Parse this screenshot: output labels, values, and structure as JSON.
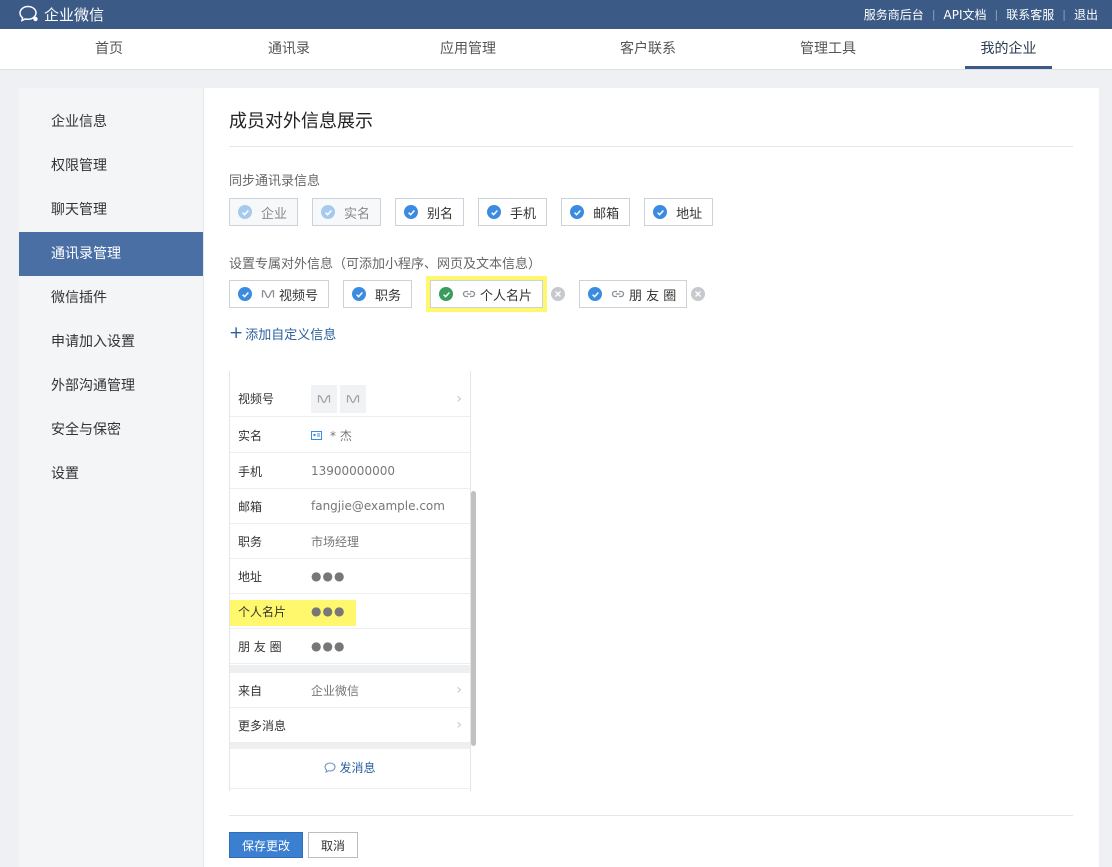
{
  "app": {
    "title": "企业微信"
  },
  "top_links": [
    "服务商后台",
    "API文档",
    "联系客服",
    "退出"
  ],
  "nav": {
    "tabs": [
      "首页",
      "通讯录",
      "应用管理",
      "客户联系",
      "管理工具",
      "我的企业"
    ],
    "active": "我的企业"
  },
  "sidebar": {
    "items": [
      "企业信息",
      "权限管理",
      "聊天管理",
      "通讯录管理",
      "微信插件",
      "申请加入设置",
      "外部沟通管理",
      "安全与保密",
      "设置"
    ],
    "active": "通讯录管理"
  },
  "main": {
    "title": "成员对外信息展示",
    "sync_label": "同步通讯录信息",
    "sync_items": [
      {
        "label": "企业",
        "checked": true,
        "disabled": true
      },
      {
        "label": "实名",
        "checked": true,
        "disabled": true
      },
      {
        "label": "别名",
        "checked": true,
        "disabled": false
      },
      {
        "label": "手机",
        "checked": true,
        "disabled": false
      },
      {
        "label": "邮箱",
        "checked": true,
        "disabled": false
      },
      {
        "label": "地址",
        "checked": true,
        "disabled": false
      }
    ],
    "custom_label": "设置专属对外信息（可添加小程序、网页及文本信息）",
    "custom_items": [
      {
        "label": "视频号",
        "icon": "channels-icon",
        "removable": false
      },
      {
        "label": "职务",
        "icon": "",
        "removable": false
      },
      {
        "label": "个人名片",
        "icon": "link-icon",
        "removable": true,
        "highlighted": true
      },
      {
        "label": "朋 友 圈",
        "icon": "link-icon",
        "removable": true
      }
    ],
    "add_custom": "添加自定义信息"
  },
  "preview": {
    "rows": [
      {
        "key": "视频号",
        "value": "",
        "type": "thumbs"
      },
      {
        "key": "实名",
        "value": "* 杰",
        "type": "name"
      },
      {
        "key": "手机",
        "value": "13900000000"
      },
      {
        "key": "邮箱",
        "value": "fangjie@example.com"
      },
      {
        "key": "职务",
        "value": "市场经理"
      },
      {
        "key": "地址",
        "value": "●●●"
      },
      {
        "key": "个人名片",
        "value": "●●●",
        "highlighted": true
      },
      {
        "key": "朋 友 圈",
        "value": "●●●"
      }
    ],
    "from": {
      "key": "来自",
      "value": "企业微信"
    },
    "more": {
      "key": "更多消息",
      "value": ""
    },
    "send": "发消息"
  },
  "buttons": {
    "save": "保存更改",
    "cancel": "取消"
  },
  "colors": {
    "topbar": "#3c5a86",
    "accent": "#4a6fa5",
    "check": "#3b8ce0",
    "highlight": "#fff86d",
    "link": "#2b5f9e"
  }
}
